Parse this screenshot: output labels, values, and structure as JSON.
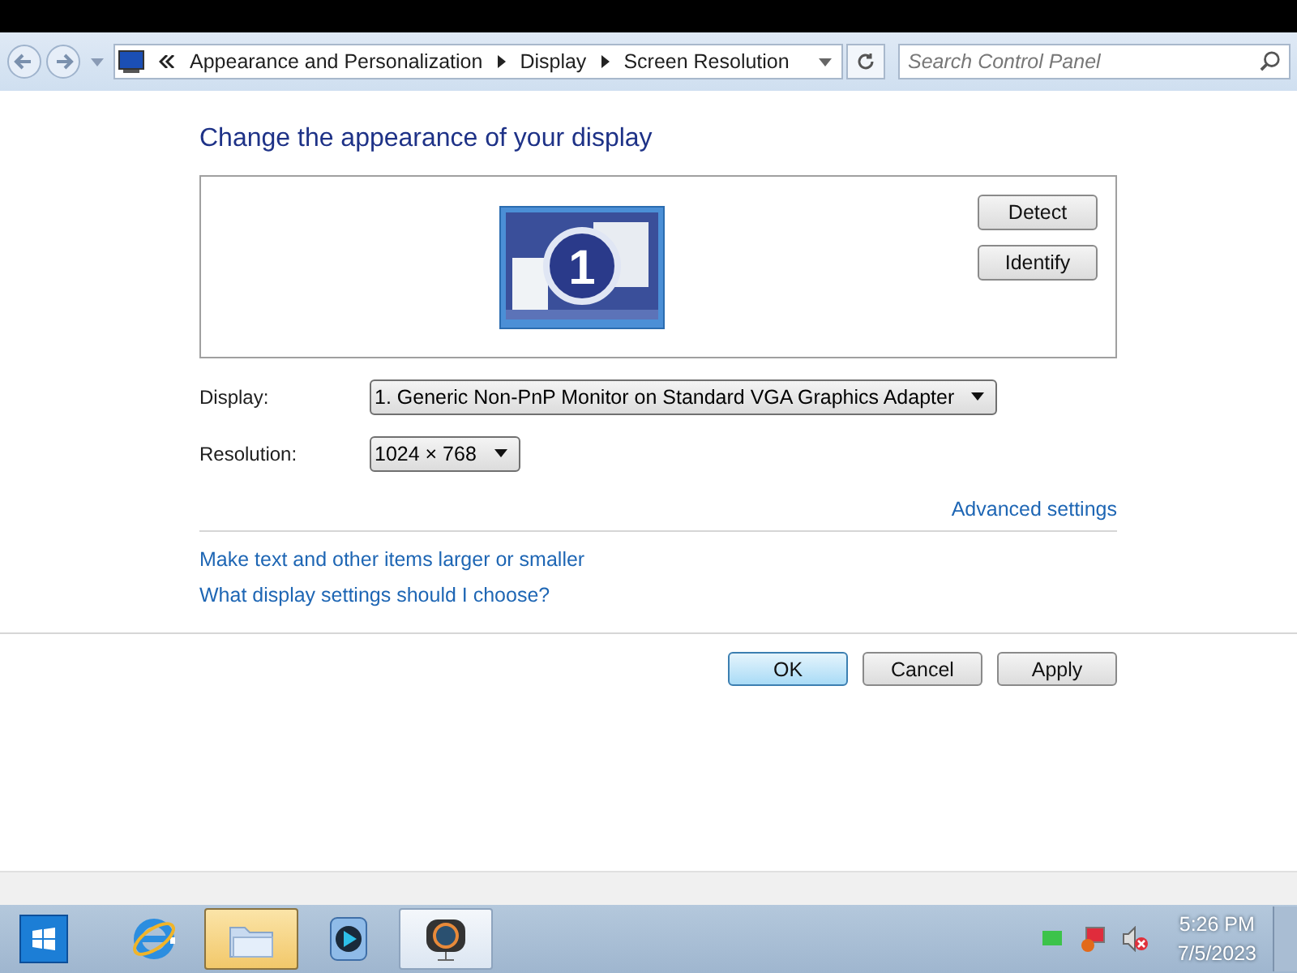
{
  "address_bar": {
    "breadcrumbs": [
      "Appearance and Personalization",
      "Display",
      "Screen Resolution"
    ],
    "search": {
      "placeholder": "Search Control Panel"
    }
  },
  "heading": "Change the appearance of your display",
  "preview": {
    "monitor_number": "1",
    "buttons": [
      "Detect",
      "Identify"
    ]
  },
  "settings": [
    {
      "label": "Display:",
      "value": "1. Generic Non-PnP Monitor on Standard VGA Graphics Adapter"
    },
    {
      "label": "Resolution:",
      "value": "1024 × 768"
    }
  ],
  "advanced_link": "Advanced settings",
  "links": [
    "Make text and other items larger or smaller",
    "What display settings should I choose?"
  ],
  "buttons": [
    {
      "label": "OK",
      "kind": "default"
    },
    {
      "label": "Cancel",
      "kind": "normal"
    },
    {
      "label": "Apply",
      "kind": "normal"
    }
  ],
  "taskbar": {
    "items": [
      {
        "kind": "ie",
        "selected": false,
        "running": false
      },
      {
        "kind": "folder",
        "selected": true,
        "running": true
      },
      {
        "kind": "media",
        "selected": false,
        "running": false
      },
      {
        "kind": "camera",
        "selected": false,
        "running": true
      }
    ],
    "clock": {
      "time": "5:26 PM",
      "date": "7/5/2023"
    }
  }
}
